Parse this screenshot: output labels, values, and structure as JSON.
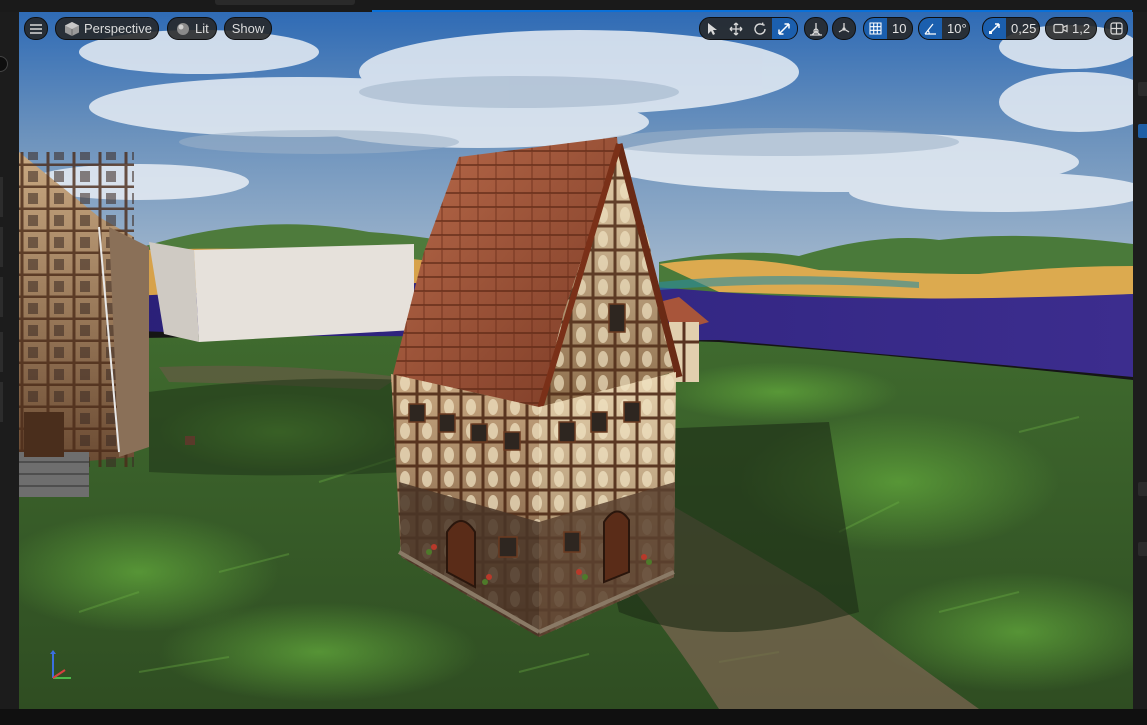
{
  "viewport": {
    "view_mode_label": "Perspective",
    "lighting_label": "Lit",
    "show_label": "Show",
    "grid_snap_value": "10",
    "rotation_snap_value": "10°",
    "scale_snap_value": "0,25",
    "camera_speed_value": "1,2"
  },
  "toolbar_icons": {
    "menu": "hamburger-menu-icon",
    "perspective": "perspective-cube-icon",
    "lit": "lit-sphere-icon",
    "select": "select-cursor-icon",
    "translate": "translate-arrows-icon",
    "rotate": "rotate-icon",
    "scale": "scale-icon",
    "surface_snap": "surface-snapping-icon",
    "world_local": "world-local-coordinates-icon",
    "grid_snap": "grid-snap-icon",
    "rotation_snap": "rotation-snap-icon",
    "scale_snap": "scale-snap-icon",
    "camera_speed": "camera-speed-icon",
    "layout": "viewport-layout-icon"
  },
  "colors": {
    "accent": "#1b5fae",
    "toolbar_bg": "#262626",
    "sky": "#3f7fc4",
    "grass": "#3d6a2a",
    "water": "#3a2a86",
    "sand": "#d9a545"
  }
}
